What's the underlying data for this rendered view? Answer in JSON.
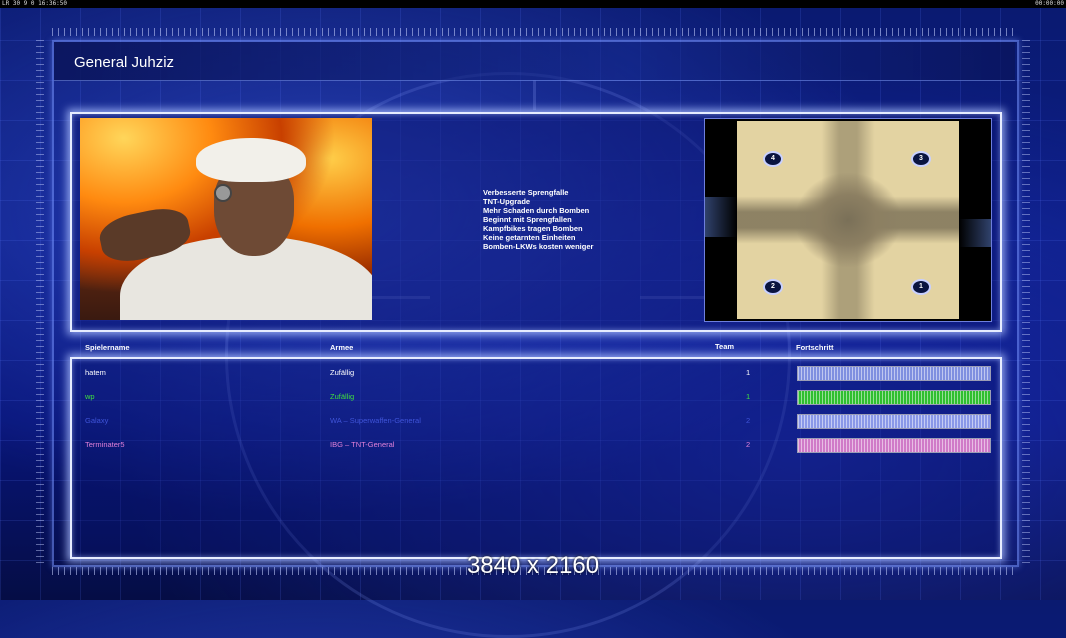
{
  "status_bar": {
    "left": "LR 30 9 0 16:36:50",
    "right": "00:00:00"
  },
  "title": "General Juhziz",
  "briefing": [
    "Verbesserte Sprengfalle",
    "TNT-Upgrade",
    "Mehr Schaden durch Bomben",
    "Beginnt mit Sprengfallen",
    "Kampfbikes tragen Bomben",
    "Keine getarnten Einheiten",
    "Bomben-LKWs kosten weniger"
  ],
  "map": {
    "spawns": [
      "4",
      "3",
      "2",
      "1"
    ]
  },
  "table": {
    "headers": {
      "player": "Spielername",
      "army": "Armee",
      "team": "Team",
      "progress": "Fortschritt"
    },
    "rows": [
      {
        "name": "hatem",
        "army": "Zufällig",
        "team": "1",
        "color": "#ffffff",
        "bar_color": "#7f8fe0",
        "progress": 1.0
      },
      {
        "name": "wp",
        "army": "Zufällig",
        "team": "1",
        "color": "#3fe03f",
        "bar_color": "#2fbf2f",
        "progress": 1.0
      },
      {
        "name": "Galaxy",
        "army": "WA – Superwaffen-General",
        "team": "2",
        "color": "#3f54d8",
        "bar_color": "#8a98e8",
        "progress": 1.0
      },
      {
        "name": "Terminater5",
        "army": "IBG – TNT-General",
        "team": "2",
        "color": "#e080d8",
        "bar_color": "#d07ac8",
        "progress": 1.0
      }
    ]
  },
  "overlay_text": "3840 x 2160"
}
